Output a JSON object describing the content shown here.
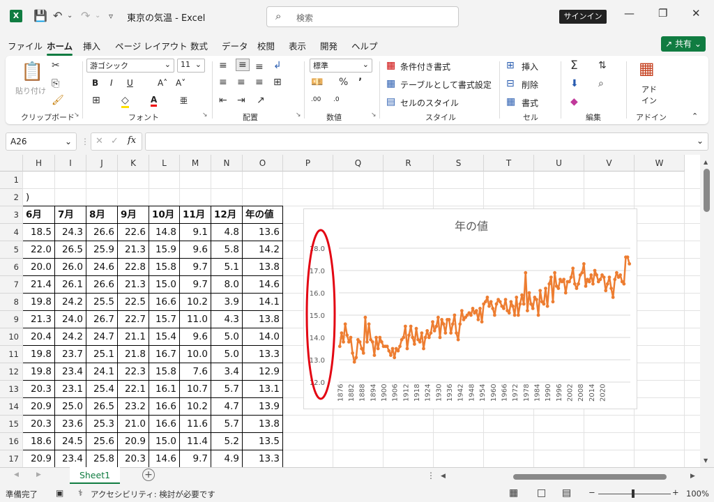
{
  "window": {
    "title": "東京の気温  -  Excel",
    "signin": "サインイン"
  },
  "search": {
    "placeholder": "検索"
  },
  "menu": {
    "items": [
      "ファイル",
      "ホーム",
      "挿入",
      "ページ レイアウト",
      "数式",
      "データ",
      "校閲",
      "表示",
      "開発",
      "ヘルプ"
    ],
    "share": "共有"
  },
  "ribbon": {
    "groups": [
      "クリップボード",
      "フォント",
      "配置",
      "数値",
      "スタイル",
      "セル",
      "編集",
      "アドイン"
    ],
    "paste": "貼り付け",
    "font_name": "游ゴシック",
    "font_size": "11",
    "number_format": "標準",
    "cond_format": "条件付き書式",
    "table_format": "テーブルとして書式設定",
    "cell_style": "セルのスタイル",
    "insert": "挿入",
    "delete": "削除",
    "format": "書式",
    "addin": "アド\nイン"
  },
  "formula_bar": {
    "name_box": "A26",
    "fx": "fx",
    "content": ""
  },
  "grid": {
    "columns": [
      "H",
      "I",
      "J",
      "K",
      "L",
      "M",
      "N",
      "O",
      "P",
      "Q",
      "R",
      "S",
      "T",
      "U",
      "V",
      "W"
    ],
    "rows": [
      "1",
      "2",
      "3",
      "4",
      "5",
      "6",
      "7",
      "8",
      "9",
      "10",
      "11",
      "12",
      "13",
      "14",
      "15",
      "16",
      "17"
    ],
    "row2_text": ")",
    "headers": [
      "6月",
      "7月",
      "8月",
      "9月",
      "10月",
      "11月",
      "12月",
      "年の値"
    ],
    "data": [
      [
        "18.5",
        "24.3",
        "26.6",
        "22.6",
        "14.8",
        "9.1",
        "4.8",
        "13.6"
      ],
      [
        "22.0",
        "26.5",
        "25.9",
        "21.3",
        "15.9",
        "9.6",
        "5.8",
        "14.2"
      ],
      [
        "20.0",
        "26.0",
        "24.6",
        "22.8",
        "15.8",
        "9.7",
        "5.1",
        "13.8"
      ],
      [
        "21.4",
        "26.1",
        "26.6",
        "21.3",
        "15.0",
        "9.7",
        "8.0",
        "14.6"
      ],
      [
        "19.8",
        "24.2",
        "25.5",
        "22.5",
        "16.6",
        "10.2",
        "3.9",
        "14.1"
      ],
      [
        "21.3",
        "24.0",
        "26.7",
        "22.7",
        "15.7",
        "11.0",
        "4.3",
        "13.8"
      ],
      [
        "20.4",
        "24.2",
        "24.7",
        "21.1",
        "15.4",
        "9.6",
        "5.0",
        "14.0"
      ],
      [
        "19.8",
        "23.7",
        "25.1",
        "21.8",
        "16.7",
        "10.0",
        "5.0",
        "13.3"
      ],
      [
        "19.8",
        "23.4",
        "24.1",
        "22.3",
        "15.8",
        "7.6",
        "3.4",
        "12.9"
      ],
      [
        "20.3",
        "23.1",
        "25.4",
        "22.1",
        "16.1",
        "10.7",
        "5.7",
        "13.1"
      ],
      [
        "20.9",
        "25.0",
        "26.5",
        "23.2",
        "16.6",
        "10.2",
        "4.7",
        "13.9"
      ],
      [
        "20.3",
        "23.6",
        "25.3",
        "21.0",
        "16.6",
        "11.6",
        "5.7",
        "13.8"
      ],
      [
        "18.6",
        "24.5",
        "25.6",
        "20.9",
        "15.0",
        "11.4",
        "5.2",
        "13.5"
      ],
      [
        "20.9",
        "23.4",
        "25.8",
        "20.3",
        "14.6",
        "9.7",
        "4.9",
        "13.3"
      ]
    ]
  },
  "chart_data": {
    "type": "line",
    "title": "年の値",
    "xlabel": "",
    "ylabel": "",
    "ylim": [
      12.0,
      18.0
    ],
    "yticks": [
      "18.0",
      "17.0",
      "16.0",
      "15.0",
      "14.0",
      "13.0",
      "12.0"
    ],
    "xticks": [
      "1876",
      "1882",
      "1888",
      "1894",
      "1900",
      "1906",
      "1912",
      "1918",
      "1924",
      "1930",
      "1936",
      "1942",
      "1948",
      "1954",
      "1960",
      "1966",
      "1972",
      "1978",
      "1984",
      "1990",
      "1996",
      "2002",
      "2008",
      "2014",
      "2020"
    ],
    "x_start": 1876,
    "series_color": "#ed7d31",
    "grid": true,
    "legend": "none",
    "series": [
      {
        "values": [
          13.6,
          14.2,
          13.8,
          14.6,
          14.1,
          13.8,
          14.0,
          13.3,
          12.9,
          13.1,
          13.9,
          13.8,
          13.5,
          13.3,
          14.9,
          13.8,
          14.6,
          13.9,
          13.8,
          13.2,
          14.0,
          13.5,
          14.0,
          13.8,
          13.6,
          13.6,
          13.6,
          13.4,
          13.2,
          13.5,
          13.1,
          13.5,
          13.4,
          13.6,
          13.9,
          14.0,
          14.5,
          13.5,
          14.1,
          14.5,
          14.0,
          13.7,
          14.4,
          13.9,
          13.8,
          14.2,
          13.5,
          14.0,
          14.3,
          14.0,
          14.2,
          14.7,
          14.3,
          14.5,
          14.9,
          14.0,
          14.8,
          14.6,
          14.2,
          14.8,
          14.8,
          14.2,
          14.6,
          15.0,
          14.2,
          13.9,
          14.6,
          15.2,
          14.8,
          14.9,
          15.0,
          15.1,
          15.0,
          15.3,
          15.1,
          15.2,
          14.8,
          15.3,
          14.7,
          15.5,
          15.6,
          15.8,
          15.4,
          15.6,
          15.3,
          15.0,
          15.5,
          15.7,
          15.6,
          15.4,
          15.3,
          15.7,
          15.2,
          15.1,
          15.6,
          15.4,
          15.0,
          15.8,
          15.0,
          15.5,
          15.9,
          15.5,
          16.9,
          15.2,
          16.0,
          15.5,
          15.3,
          15.8,
          15.7,
          15.0,
          16.1,
          15.6,
          15.5,
          16.2,
          15.4,
          16.4,
          16.7,
          15.6,
          16.9,
          16.3,
          16.2,
          16.6,
          16.5,
          16.6,
          16.0,
          16.5,
          16.5,
          16.7,
          17.1,
          16.4,
          16.2,
          16.4,
          16.8,
          16.9,
          17.3,
          16.3,
          16.6,
          16.5,
          16.8,
          16.4,
          17.0,
          16.8,
          16.5,
          16.6,
          16.8,
          16.7,
          16.1,
          16.4,
          16.7,
          16.2,
          15.8,
          16.6,
          16.9,
          16.7,
          16.8,
          16.5,
          16.4,
          17.6,
          17.6,
          17.3
        ]
      }
    ]
  },
  "sheet": {
    "tab": "Sheet1",
    "add": "+"
  },
  "status": {
    "ready": "準備完了",
    "accessibility": "アクセシビリティ: 検討が必要です",
    "zoom": "100%"
  }
}
